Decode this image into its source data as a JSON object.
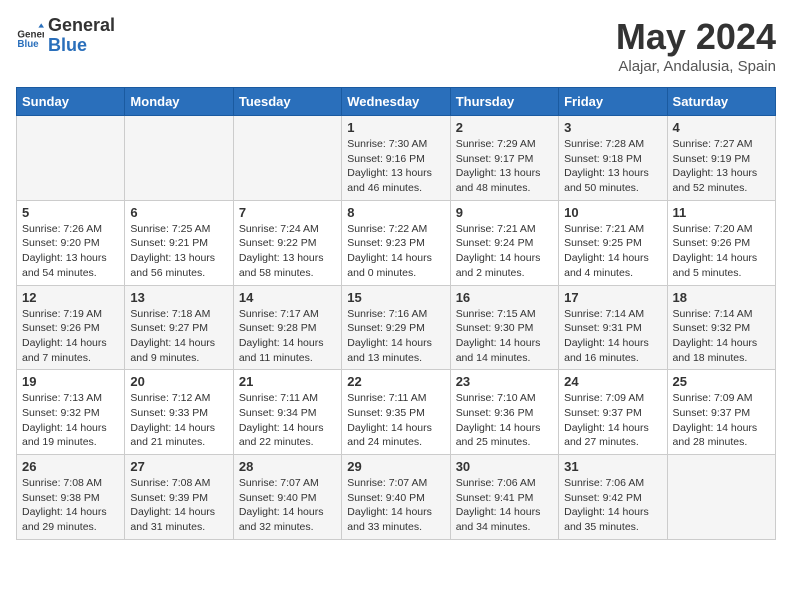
{
  "header": {
    "logo_general": "General",
    "logo_blue": "Blue",
    "month_title": "May 2024",
    "location": "Alajar, Andalusia, Spain"
  },
  "days_of_week": [
    "Sunday",
    "Monday",
    "Tuesday",
    "Wednesday",
    "Thursday",
    "Friday",
    "Saturday"
  ],
  "weeks": [
    [
      {
        "day": "",
        "info": ""
      },
      {
        "day": "",
        "info": ""
      },
      {
        "day": "",
        "info": ""
      },
      {
        "day": "1",
        "info": "Sunrise: 7:30 AM\nSunset: 9:16 PM\nDaylight: 13 hours and 46 minutes."
      },
      {
        "day": "2",
        "info": "Sunrise: 7:29 AM\nSunset: 9:17 PM\nDaylight: 13 hours and 48 minutes."
      },
      {
        "day": "3",
        "info": "Sunrise: 7:28 AM\nSunset: 9:18 PM\nDaylight: 13 hours and 50 minutes."
      },
      {
        "day": "4",
        "info": "Sunrise: 7:27 AM\nSunset: 9:19 PM\nDaylight: 13 hours and 52 minutes."
      }
    ],
    [
      {
        "day": "5",
        "info": "Sunrise: 7:26 AM\nSunset: 9:20 PM\nDaylight: 13 hours and 54 minutes."
      },
      {
        "day": "6",
        "info": "Sunrise: 7:25 AM\nSunset: 9:21 PM\nDaylight: 13 hours and 56 minutes."
      },
      {
        "day": "7",
        "info": "Sunrise: 7:24 AM\nSunset: 9:22 PM\nDaylight: 13 hours and 58 minutes."
      },
      {
        "day": "8",
        "info": "Sunrise: 7:22 AM\nSunset: 9:23 PM\nDaylight: 14 hours and 0 minutes."
      },
      {
        "day": "9",
        "info": "Sunrise: 7:21 AM\nSunset: 9:24 PM\nDaylight: 14 hours and 2 minutes."
      },
      {
        "day": "10",
        "info": "Sunrise: 7:21 AM\nSunset: 9:25 PM\nDaylight: 14 hours and 4 minutes."
      },
      {
        "day": "11",
        "info": "Sunrise: 7:20 AM\nSunset: 9:26 PM\nDaylight: 14 hours and 5 minutes."
      }
    ],
    [
      {
        "day": "12",
        "info": "Sunrise: 7:19 AM\nSunset: 9:26 PM\nDaylight: 14 hours and 7 minutes."
      },
      {
        "day": "13",
        "info": "Sunrise: 7:18 AM\nSunset: 9:27 PM\nDaylight: 14 hours and 9 minutes."
      },
      {
        "day": "14",
        "info": "Sunrise: 7:17 AM\nSunset: 9:28 PM\nDaylight: 14 hours and 11 minutes."
      },
      {
        "day": "15",
        "info": "Sunrise: 7:16 AM\nSunset: 9:29 PM\nDaylight: 14 hours and 13 minutes."
      },
      {
        "day": "16",
        "info": "Sunrise: 7:15 AM\nSunset: 9:30 PM\nDaylight: 14 hours and 14 minutes."
      },
      {
        "day": "17",
        "info": "Sunrise: 7:14 AM\nSunset: 9:31 PM\nDaylight: 14 hours and 16 minutes."
      },
      {
        "day": "18",
        "info": "Sunrise: 7:14 AM\nSunset: 9:32 PM\nDaylight: 14 hours and 18 minutes."
      }
    ],
    [
      {
        "day": "19",
        "info": "Sunrise: 7:13 AM\nSunset: 9:32 PM\nDaylight: 14 hours and 19 minutes."
      },
      {
        "day": "20",
        "info": "Sunrise: 7:12 AM\nSunset: 9:33 PM\nDaylight: 14 hours and 21 minutes."
      },
      {
        "day": "21",
        "info": "Sunrise: 7:11 AM\nSunset: 9:34 PM\nDaylight: 14 hours and 22 minutes."
      },
      {
        "day": "22",
        "info": "Sunrise: 7:11 AM\nSunset: 9:35 PM\nDaylight: 14 hours and 24 minutes."
      },
      {
        "day": "23",
        "info": "Sunrise: 7:10 AM\nSunset: 9:36 PM\nDaylight: 14 hours and 25 minutes."
      },
      {
        "day": "24",
        "info": "Sunrise: 7:09 AM\nSunset: 9:37 PM\nDaylight: 14 hours and 27 minutes."
      },
      {
        "day": "25",
        "info": "Sunrise: 7:09 AM\nSunset: 9:37 PM\nDaylight: 14 hours and 28 minutes."
      }
    ],
    [
      {
        "day": "26",
        "info": "Sunrise: 7:08 AM\nSunset: 9:38 PM\nDaylight: 14 hours and 29 minutes."
      },
      {
        "day": "27",
        "info": "Sunrise: 7:08 AM\nSunset: 9:39 PM\nDaylight: 14 hours and 31 minutes."
      },
      {
        "day": "28",
        "info": "Sunrise: 7:07 AM\nSunset: 9:40 PM\nDaylight: 14 hours and 32 minutes."
      },
      {
        "day": "29",
        "info": "Sunrise: 7:07 AM\nSunset: 9:40 PM\nDaylight: 14 hours and 33 minutes."
      },
      {
        "day": "30",
        "info": "Sunrise: 7:06 AM\nSunset: 9:41 PM\nDaylight: 14 hours and 34 minutes."
      },
      {
        "day": "31",
        "info": "Sunrise: 7:06 AM\nSunset: 9:42 PM\nDaylight: 14 hours and 35 minutes."
      },
      {
        "day": "",
        "info": ""
      }
    ]
  ]
}
